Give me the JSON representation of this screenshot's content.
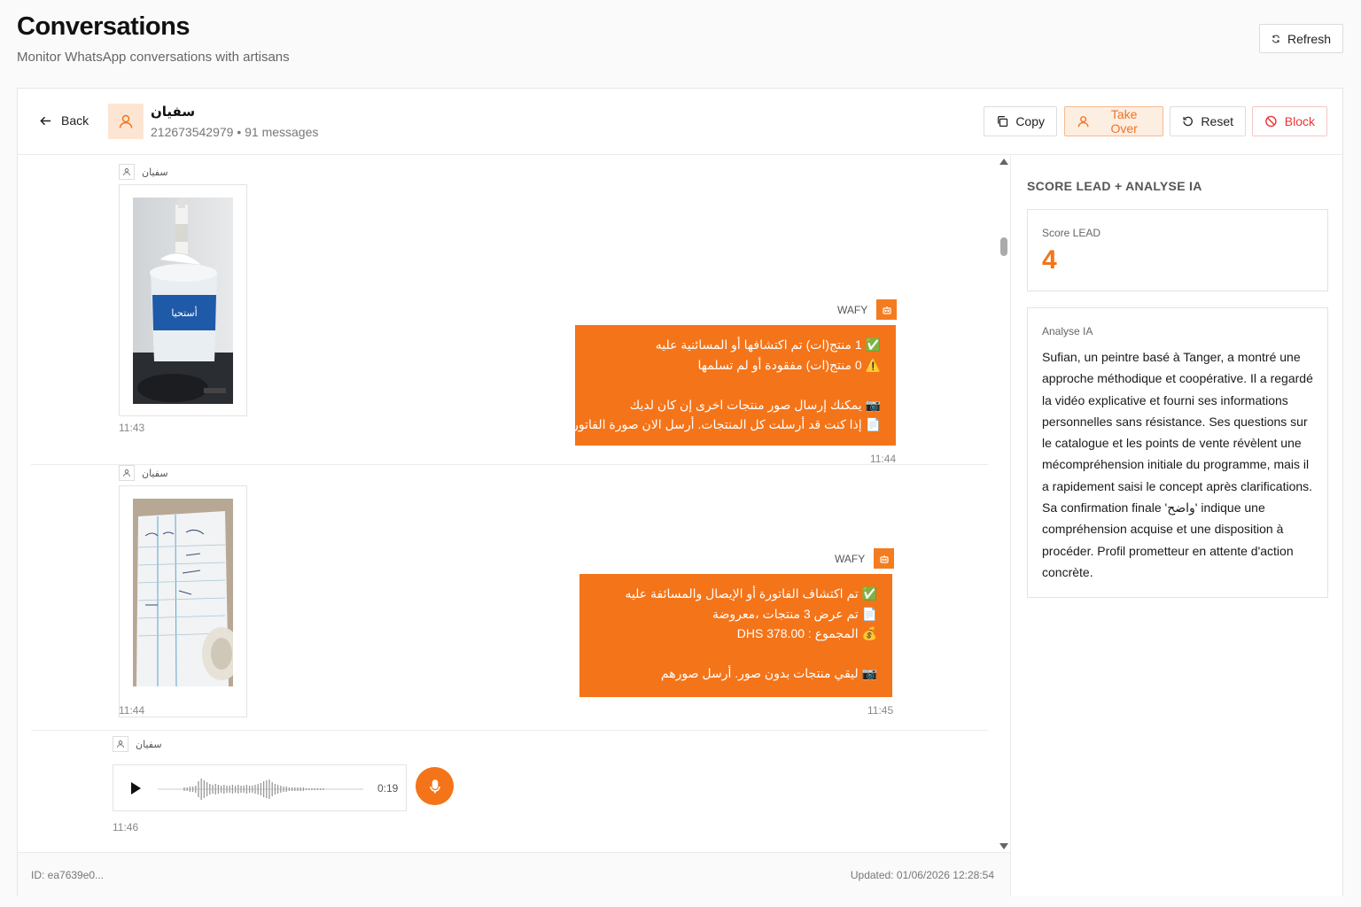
{
  "page": {
    "title": "Conversations",
    "subtitle": "Monitor WhatsApp conversations with artisans",
    "refresh_label": "Refresh"
  },
  "header": {
    "back_label": "Back",
    "contact_name": "سفيان",
    "contact_meta": "212673542979 • 91 messages",
    "copy_label": "Copy",
    "takeover_label": "Take Over",
    "reset_label": "Reset",
    "block_label": "Block"
  },
  "messages": [
    {
      "sender": "سفيان",
      "type": "image",
      "image_desc": "paint-can-photo",
      "time": "11:43"
    },
    {
      "sender": "WAFY",
      "type": "text",
      "lines": [
        "✅ 1 منتج(ات) تم اكتشافها أو المسائنية عليه",
        "⚠️ 0 منتج(ات) مفقودة أو لم تسلمها",
        "",
        "📷 يمكنك إرسال صور منتجات اخرى إن كان لديك",
        "📄 إذا كنت قد أرسلت كل المنتجات. أرسل الان صورة الفاتورة"
      ],
      "time": "11:44"
    },
    {
      "sender": "سفيان",
      "type": "image",
      "image_desc": "receipt-photo",
      "time": "11:44"
    },
    {
      "sender": "WAFY",
      "type": "text",
      "lines": [
        "✅ تم اكتشاف الفاتورة أو الإيصال والمسائفة عليه",
        "📄 تم عرض 3 منتجات ،معروضة",
        "💰 المجموع : DHS 378.00",
        "",
        "📷 ليقي منتجات بدون صور. أرسل صورهم"
      ],
      "time": "11:45"
    },
    {
      "sender": "سفيان",
      "type": "audio",
      "duration": "0:19",
      "time": "11:46"
    }
  ],
  "footer": {
    "id": "ID: ea7639e0...",
    "updated": "Updated: 01/06/2026 12:28:54"
  },
  "sidebar": {
    "heading": "SCORE LEAD + ANALYSE IA",
    "score_label": "Score LEAD",
    "score_value": "4",
    "analyse_label": "Analyse IA",
    "analyse_text": "Sufian, un peintre basé à Tanger, a montré une approche méthodique et coopérative. Il a regardé la vidéo explicative et fourni ses informations personnelles sans résistance. Ses questions sur le catalogue et les points de vente révèlent une mécompréhension initiale du programme, mais il a rapidement saisi le concept après clarifications. Sa confirmation finale 'واضح' indique une compréhension acquise et une disposition à procéder. Profil prometteur en attente d'action concrète."
  },
  "colors": {
    "accent": "#f47419",
    "accent_light": "#fde5d3",
    "danger": "#e33333"
  }
}
